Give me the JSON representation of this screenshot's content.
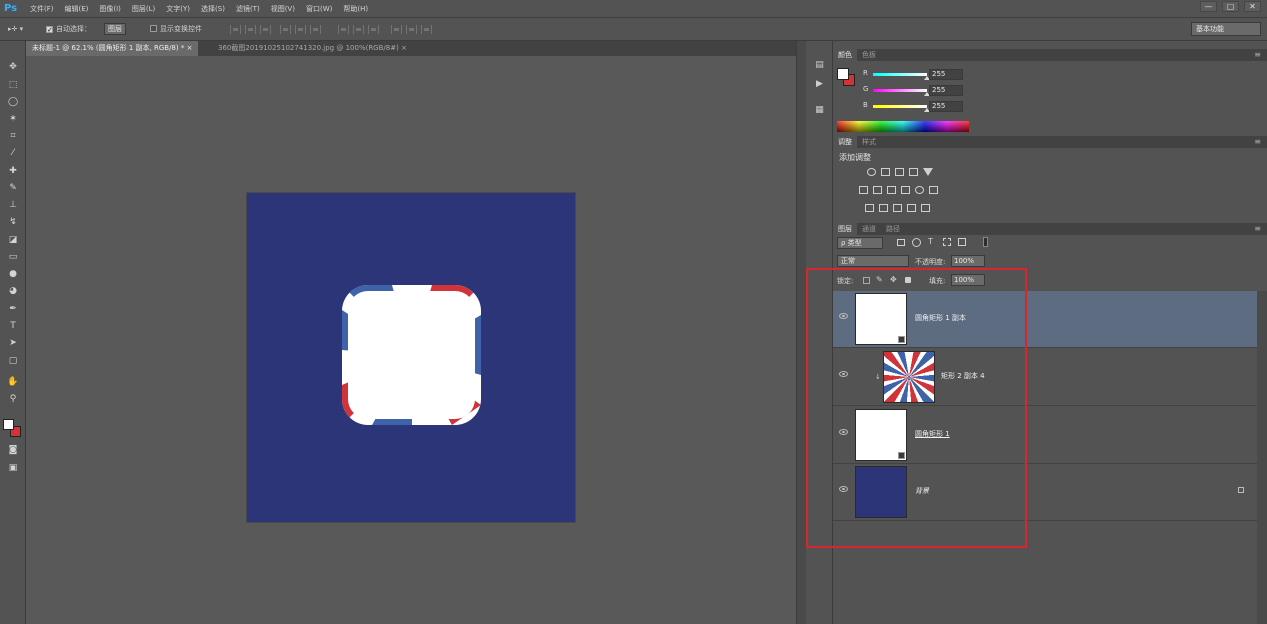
{
  "app": {
    "logo": "Ps",
    "accent": "#36b1f5"
  },
  "menu": [
    "文件(F)",
    "编辑(E)",
    "图像(I)",
    "图层(L)",
    "文字(Y)",
    "选择(S)",
    "滤镜(T)",
    "视图(V)",
    "窗口(W)",
    "帮助(H)"
  ],
  "window_controls": [
    "—",
    "▢",
    "✕"
  ],
  "options": {
    "tool_glyph": "▸✛ ▾",
    "auto_select_label": "自动选择：",
    "auto_select_value": "图层",
    "transform_label": "显示变换控件",
    "workspace": "基本功能"
  },
  "tabs": [
    {
      "label": "未标题-1 @ 62.1% (圆角矩形 1 副本, RGB/8) *",
      "close": "×"
    },
    {
      "label": "360截图20191025102741320.jpg @ 100%(RGB/8#)",
      "close": "×"
    }
  ],
  "document": {
    "background": "#2b3577"
  },
  "color_panel": {
    "tabs": [
      "颜色",
      "色板"
    ],
    "foreground": "#ffffff",
    "background": "#d0343a",
    "channels": [
      {
        "label": "R",
        "value": "255"
      },
      {
        "label": "G",
        "value": "255"
      },
      {
        "label": "B",
        "value": "255"
      }
    ]
  },
  "adjust_panel": {
    "tabs": [
      "调整",
      "样式"
    ],
    "title": "添加调整"
  },
  "layers_panel": {
    "tabs": [
      "图层",
      "通道",
      "路径"
    ],
    "filter_label": "ρ 类型",
    "blend_mode": "正常",
    "opacity_label": "不透明度:",
    "opacity_value": "100%",
    "lock_label": "锁定:",
    "fill_label": "填充:",
    "fill_value": "100%",
    "layers": [
      {
        "name": "圆角矩形 1 副本",
        "selected": true
      },
      {
        "name": "矩形 2 副本 4",
        "selected": false
      },
      {
        "name": "圆角矩形 1",
        "selected": false
      },
      {
        "name": "背景",
        "selected": false
      }
    ]
  },
  "colors": {
    "highlight": "#d7262e",
    "selection": "#5e6c82"
  }
}
